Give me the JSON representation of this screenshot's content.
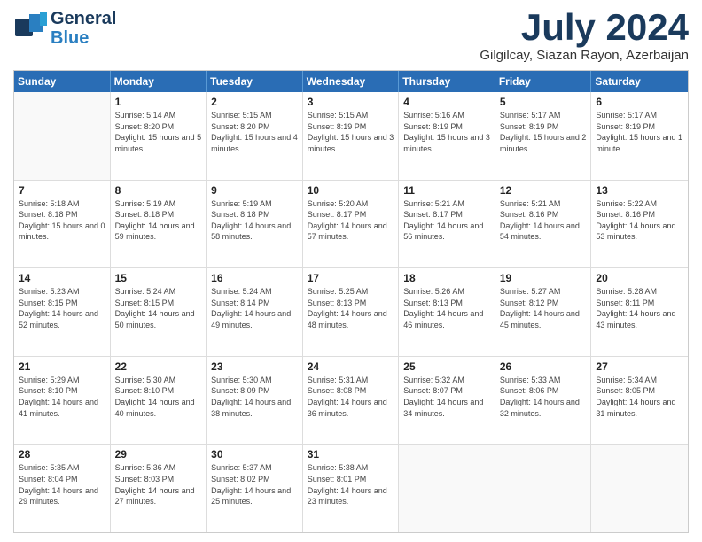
{
  "logo": {
    "line1": "General",
    "line2": "Blue"
  },
  "title": "July 2024",
  "location": "Gilgilcay, Siazan Rayon, Azerbaijan",
  "header_days": [
    "Sunday",
    "Monday",
    "Tuesday",
    "Wednesday",
    "Thursday",
    "Friday",
    "Saturday"
  ],
  "weeks": [
    [
      {
        "day": "",
        "sunrise": "",
        "sunset": "",
        "daylight": ""
      },
      {
        "day": "1",
        "sunrise": "Sunrise: 5:14 AM",
        "sunset": "Sunset: 8:20 PM",
        "daylight": "Daylight: 15 hours and 5 minutes."
      },
      {
        "day": "2",
        "sunrise": "Sunrise: 5:15 AM",
        "sunset": "Sunset: 8:20 PM",
        "daylight": "Daylight: 15 hours and 4 minutes."
      },
      {
        "day": "3",
        "sunrise": "Sunrise: 5:15 AM",
        "sunset": "Sunset: 8:19 PM",
        "daylight": "Daylight: 15 hours and 3 minutes."
      },
      {
        "day": "4",
        "sunrise": "Sunrise: 5:16 AM",
        "sunset": "Sunset: 8:19 PM",
        "daylight": "Daylight: 15 hours and 3 minutes."
      },
      {
        "day": "5",
        "sunrise": "Sunrise: 5:17 AM",
        "sunset": "Sunset: 8:19 PM",
        "daylight": "Daylight: 15 hours and 2 minutes."
      },
      {
        "day": "6",
        "sunrise": "Sunrise: 5:17 AM",
        "sunset": "Sunset: 8:19 PM",
        "daylight": "Daylight: 15 hours and 1 minute."
      }
    ],
    [
      {
        "day": "7",
        "sunrise": "Sunrise: 5:18 AM",
        "sunset": "Sunset: 8:18 PM",
        "daylight": "Daylight: 15 hours and 0 minutes."
      },
      {
        "day": "8",
        "sunrise": "Sunrise: 5:19 AM",
        "sunset": "Sunset: 8:18 PM",
        "daylight": "Daylight: 14 hours and 59 minutes."
      },
      {
        "day": "9",
        "sunrise": "Sunrise: 5:19 AM",
        "sunset": "Sunset: 8:18 PM",
        "daylight": "Daylight: 14 hours and 58 minutes."
      },
      {
        "day": "10",
        "sunrise": "Sunrise: 5:20 AM",
        "sunset": "Sunset: 8:17 PM",
        "daylight": "Daylight: 14 hours and 57 minutes."
      },
      {
        "day": "11",
        "sunrise": "Sunrise: 5:21 AM",
        "sunset": "Sunset: 8:17 PM",
        "daylight": "Daylight: 14 hours and 56 minutes."
      },
      {
        "day": "12",
        "sunrise": "Sunrise: 5:21 AM",
        "sunset": "Sunset: 8:16 PM",
        "daylight": "Daylight: 14 hours and 54 minutes."
      },
      {
        "day": "13",
        "sunrise": "Sunrise: 5:22 AM",
        "sunset": "Sunset: 8:16 PM",
        "daylight": "Daylight: 14 hours and 53 minutes."
      }
    ],
    [
      {
        "day": "14",
        "sunrise": "Sunrise: 5:23 AM",
        "sunset": "Sunset: 8:15 PM",
        "daylight": "Daylight: 14 hours and 52 minutes."
      },
      {
        "day": "15",
        "sunrise": "Sunrise: 5:24 AM",
        "sunset": "Sunset: 8:15 PM",
        "daylight": "Daylight: 14 hours and 50 minutes."
      },
      {
        "day": "16",
        "sunrise": "Sunrise: 5:24 AM",
        "sunset": "Sunset: 8:14 PM",
        "daylight": "Daylight: 14 hours and 49 minutes."
      },
      {
        "day": "17",
        "sunrise": "Sunrise: 5:25 AM",
        "sunset": "Sunset: 8:13 PM",
        "daylight": "Daylight: 14 hours and 48 minutes."
      },
      {
        "day": "18",
        "sunrise": "Sunrise: 5:26 AM",
        "sunset": "Sunset: 8:13 PM",
        "daylight": "Daylight: 14 hours and 46 minutes."
      },
      {
        "day": "19",
        "sunrise": "Sunrise: 5:27 AM",
        "sunset": "Sunset: 8:12 PM",
        "daylight": "Daylight: 14 hours and 45 minutes."
      },
      {
        "day": "20",
        "sunrise": "Sunrise: 5:28 AM",
        "sunset": "Sunset: 8:11 PM",
        "daylight": "Daylight: 14 hours and 43 minutes."
      }
    ],
    [
      {
        "day": "21",
        "sunrise": "Sunrise: 5:29 AM",
        "sunset": "Sunset: 8:10 PM",
        "daylight": "Daylight: 14 hours and 41 minutes."
      },
      {
        "day": "22",
        "sunrise": "Sunrise: 5:30 AM",
        "sunset": "Sunset: 8:10 PM",
        "daylight": "Daylight: 14 hours and 40 minutes."
      },
      {
        "day": "23",
        "sunrise": "Sunrise: 5:30 AM",
        "sunset": "Sunset: 8:09 PM",
        "daylight": "Daylight: 14 hours and 38 minutes."
      },
      {
        "day": "24",
        "sunrise": "Sunrise: 5:31 AM",
        "sunset": "Sunset: 8:08 PM",
        "daylight": "Daylight: 14 hours and 36 minutes."
      },
      {
        "day": "25",
        "sunrise": "Sunrise: 5:32 AM",
        "sunset": "Sunset: 8:07 PM",
        "daylight": "Daylight: 14 hours and 34 minutes."
      },
      {
        "day": "26",
        "sunrise": "Sunrise: 5:33 AM",
        "sunset": "Sunset: 8:06 PM",
        "daylight": "Daylight: 14 hours and 32 minutes."
      },
      {
        "day": "27",
        "sunrise": "Sunrise: 5:34 AM",
        "sunset": "Sunset: 8:05 PM",
        "daylight": "Daylight: 14 hours and 31 minutes."
      }
    ],
    [
      {
        "day": "28",
        "sunrise": "Sunrise: 5:35 AM",
        "sunset": "Sunset: 8:04 PM",
        "daylight": "Daylight: 14 hours and 29 minutes."
      },
      {
        "day": "29",
        "sunrise": "Sunrise: 5:36 AM",
        "sunset": "Sunset: 8:03 PM",
        "daylight": "Daylight: 14 hours and 27 minutes."
      },
      {
        "day": "30",
        "sunrise": "Sunrise: 5:37 AM",
        "sunset": "Sunset: 8:02 PM",
        "daylight": "Daylight: 14 hours and 25 minutes."
      },
      {
        "day": "31",
        "sunrise": "Sunrise: 5:38 AM",
        "sunset": "Sunset: 8:01 PM",
        "daylight": "Daylight: 14 hours and 23 minutes."
      },
      {
        "day": "",
        "sunrise": "",
        "sunset": "",
        "daylight": ""
      },
      {
        "day": "",
        "sunrise": "",
        "sunset": "",
        "daylight": ""
      },
      {
        "day": "",
        "sunrise": "",
        "sunset": "",
        "daylight": ""
      }
    ]
  ]
}
